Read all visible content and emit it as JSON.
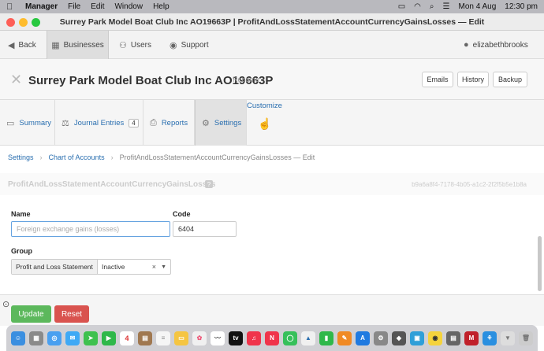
{
  "menubar": {
    "app_name": "Manager",
    "items": [
      "File",
      "Edit",
      "Window",
      "Help"
    ],
    "date": "Mon 4 Aug",
    "time": "12:30 pm"
  },
  "window": {
    "title": "Surrey Park Model Boat Club Inc AO19663P | ProfitAndLossStatementAccountCurrencyGainsLosses — Edit"
  },
  "nav": {
    "back": "Back",
    "businesses": "Businesses",
    "users": "Users",
    "support": "Support",
    "user": "elizabethbrooks"
  },
  "header": {
    "business_name": "Surrey Park Model Boat Club Inc AO19663P",
    "rename": "Rename",
    "buttons": [
      "Emails",
      "History",
      "Backup"
    ]
  },
  "tabs": {
    "summary": "Summary",
    "journal_entries": "Journal Entries",
    "journal_count": "4",
    "reports": "Reports",
    "settings": "Settings",
    "customize": "Customize"
  },
  "breadcrumb": {
    "settings": "Settings",
    "chart_of_accounts": "Chart of Accounts",
    "current": "ProfitAndLossStatementAccountCurrencyGainsLosses — Edit"
  },
  "section": {
    "title": "ProfitAndLossStatementAccountCurrencyGainsLosses",
    "help": "?",
    "guid": "b9a6a8f4-7178-4b05-a1c2-2f2f5b5e1b8a"
  },
  "form": {
    "name_label": "Name",
    "name_placeholder": "Foreign exchange gains (losses)",
    "code_label": "Code",
    "code_value": "6404",
    "group_label": "Group",
    "group_addon": "Profit and Loss Statement",
    "group_value": "Inactive"
  },
  "footer": {
    "update": "Update",
    "reset": "Reset"
  },
  "dock": {
    "calendar_day": "4"
  },
  "colors": {
    "link": "#2a6fb0",
    "update": "#5cb85c",
    "reset": "#d9534f"
  }
}
